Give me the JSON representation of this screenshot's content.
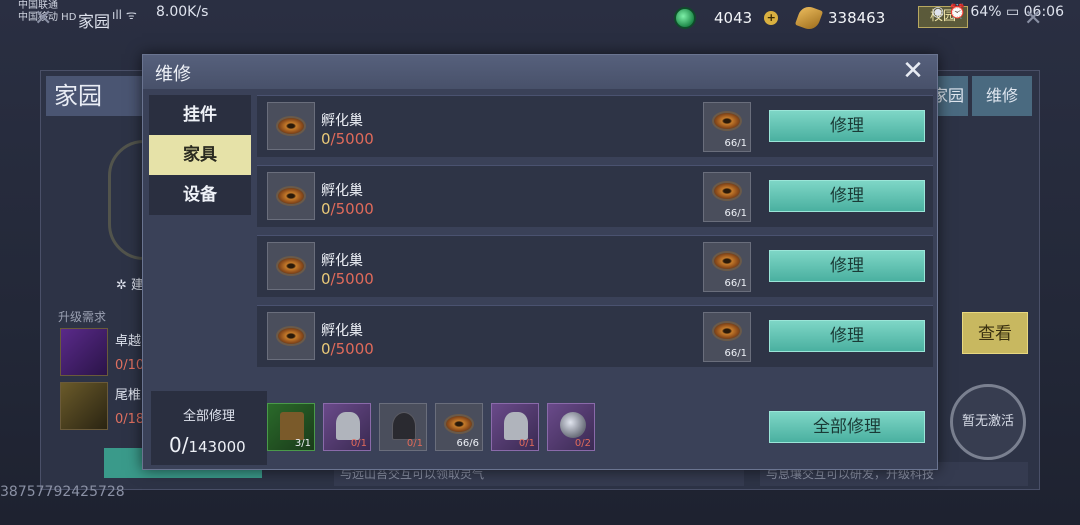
{
  "status_bar": {
    "carrier_line1": "中国联通",
    "carrier_line2": "中国移动 HD",
    "home_label": "家园",
    "signal": "ıll ᯤ",
    "speed": "8.00K/s",
    "right": "◉ ⏰ 64% ▭ 06:06"
  },
  "resources": {
    "jade": "4043",
    "coin": "338463",
    "badge": "校园"
  },
  "background": {
    "title": "家园",
    "tab_home": "家园",
    "tab_repair": "维修",
    "build_label": "建",
    "upgrade_req": "升级需求",
    "item1_name": "卓越",
    "item1_count": "0/10",
    "item2_name": "尾椎",
    "item2_count": "0/18",
    "view_button": "查看",
    "inactive": "暂无激活",
    "footer_mid": "与远山苔交互可以领取灵气",
    "footer_right": "与息壤交互可以研发，升级科技",
    "user_id": "38757792425728"
  },
  "modal": {
    "title": "维修",
    "close": "✕",
    "tabs": [
      {
        "label": "挂件"
      },
      {
        "label": "家具"
      },
      {
        "label": "设备"
      }
    ],
    "rows": [
      {
        "name": "孵化巢",
        "current": "0",
        "total": "/5000",
        "need": "66/1",
        "button": "修理"
      },
      {
        "name": "孵化巢",
        "current": "0",
        "total": "/5000",
        "need": "66/1",
        "button": "修理"
      },
      {
        "name": "孵化巢",
        "current": "0",
        "total": "/5000",
        "need": "66/1",
        "button": "修理"
      },
      {
        "name": "孵化巢",
        "current": "0",
        "total": "/5000",
        "need": "66/1",
        "button": "修理"
      }
    ],
    "repair_all": {
      "label": "全部修理",
      "current": "0/",
      "total": "143000",
      "button": "全部修理"
    },
    "materials": [
      {
        "icon": "chair-icon",
        "have": "3",
        "need": "/1",
        "short": false
      },
      {
        "icon": "lion-statue-icon",
        "have": "0",
        "need": "/1",
        "short": true
      },
      {
        "icon": "lamp-icon",
        "have": "0",
        "need": "/1",
        "short": true
      },
      {
        "icon": "eye-nest-icon",
        "have": "66",
        "need": "/6",
        "short": false
      },
      {
        "icon": "lion-statue-icon",
        "have": "0",
        "need": "/1",
        "short": true
      },
      {
        "icon": "crystal-ball-icon",
        "have": "0",
        "need": "/2",
        "short": true
      }
    ]
  }
}
